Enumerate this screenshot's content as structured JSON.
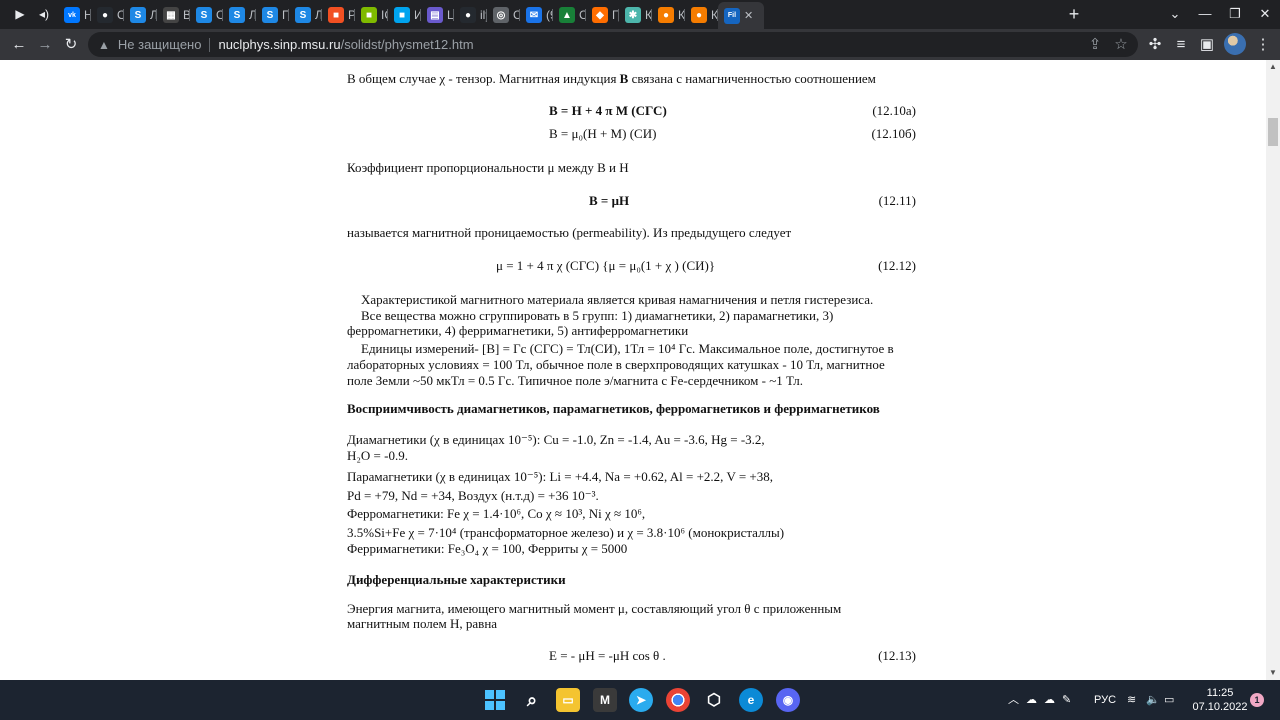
{
  "tabs": [
    {
      "label": "Но",
      "icon": "vk-icon",
      "color": "#0077ff",
      "glyph": "vk"
    },
    {
      "label": "OS",
      "icon": "github-icon",
      "color": "#24292f",
      "glyph": "●"
    },
    {
      "label": "Ла",
      "icon": "s-icon",
      "color": "#1e88e5",
      "glyph": "S"
    },
    {
      "label": "Ва",
      "icon": "grid-icon",
      "color": "#444444",
      "glyph": "▦"
    },
    {
      "label": "Ол",
      "icon": "s-icon",
      "color": "#1e88e5",
      "glyph": "S"
    },
    {
      "label": "Ле",
      "icon": "s-icon",
      "color": "#1e88e5",
      "glyph": "S"
    },
    {
      "label": "Пр",
      "icon": "s-icon",
      "color": "#1e88e5",
      "glyph": "S"
    },
    {
      "label": "Ла",
      "icon": "s-icon",
      "color": "#1e88e5",
      "glyph": "S"
    },
    {
      "label": "Рук",
      "icon": "windows-icon",
      "color": "#f25022",
      "glyph": "■"
    },
    {
      "label": "ICo",
      "icon": "windows-icon",
      "color": "#7fba00",
      "glyph": "■"
    },
    {
      "label": "Ин",
      "icon": "windows-icon",
      "color": "#00a4ef",
      "glyph": "■"
    },
    {
      "label": "Lab",
      "icon": "book-icon",
      "color": "#6a5acd",
      "glyph": "▤"
    },
    {
      "label": "ilya",
      "icon": "github-icon",
      "color": "#24292f",
      "glyph": "●"
    },
    {
      "label": "Co",
      "icon": "globe-icon",
      "color": "#5f6368",
      "glyph": "◎"
    },
    {
      "label": "(91",
      "icon": "mail-icon",
      "color": "#1a73e8",
      "glyph": "✉"
    },
    {
      "label": "Cla",
      "icon": "drive-icon",
      "color": "#188038",
      "glyph": "▲"
    },
    {
      "label": "Гра",
      "icon": "shape-icon",
      "color": "#ff6d00",
      "glyph": "◆"
    },
    {
      "label": "Ко",
      "icon": "star-icon",
      "color": "#4db6ac",
      "glyph": "✱"
    },
    {
      "label": "Ко",
      "icon": "orange-icon",
      "color": "#f57c00",
      "glyph": "●"
    },
    {
      "label": "Ко",
      "icon": "orange-icon",
      "color": "#f57c00",
      "glyph": "●"
    },
    {
      "label": "Fili",
      "icon": "fil-icon",
      "color": "#1565c0",
      "glyph": "Fil"
    }
  ],
  "toolbar": {
    "security_label": "Не защищено",
    "host": "nuclphys.sinp.msu.ru",
    "path": "/solidst/physmet12.htm"
  },
  "content": {
    "p1_a": "В общем случае ",
    "chi": "χ",
    "p1_b": " - тензор. Магнитная индукция ",
    "B": "B",
    "p1_c": " связана с намагниченностью соотношением",
    "eq10a": "B = H + 4 π M (СГС)",
    "eq10a_num": "(12.10а)",
    "eq10b": "B = μ₀(H + M) (СИ)",
    "eq10b_num": "(12.10б)",
    "p2": "Коэффициент пропорциональности μ между B и H",
    "eq11": "B = μH",
    "eq11_num": "(12.11)",
    "p3": "называется магнитной проницаемостью (permeability). Из предыдущего следует",
    "eq12": "μ = 1 + 4 π χ (СГС) {μ = μ₀(1 + χ ) (СИ)}",
    "eq12_num": "(12.12)",
    "para1": "Характеристикой магнитного материала является кривая намагничения и петля гистерезиса.",
    "para2_l1": "Все вещества можно сгруппировать в 5 групп: 1) диамагнетики, 2) парамагнетики, 3)",
    "para2_l2": "ферромагнетики, 4) ферримагнетики, 5) антиферромагнетики",
    "para3_l1": "Единицы измерений- [B] = Гс (СГС) = Тл(СИ), 1Тл = 10⁴ Гс. Максимальное поле, достигнутое в",
    "para3_l2": "лабораторных условиях = 100 Тл, обычное поле в сверхпроводящих катушках - 10 Тл, магнитное",
    "para3_l3": "поле Земли ~50 мкТл = 0.5 Гс. Типичное поле э/магнита с Fe-сердечником - ~1 Тл.",
    "heading1": "Восприимчивость диамагнетиков, парамагнетиков, ферромагнетиков и ферримагнетиков",
    "dia_l1": "Диамагнетики (χ в единицах 10⁻⁵): Cu = -1.0, Zn = -1.4, Au = -3.6, Hg = -3.2,",
    "dia_l2": "H₂O = -0.9.",
    "para_l1": "Парамагнетики (χ в единицах 10⁻⁵): Li = +4.4, Na = +0.62, Al = +2.2, V = +38,",
    "para_l2": "Pd = +79, Nd = +34, Воздух (н.т.д) = +36 10⁻³.",
    "ferro_l1": "Ферромагнетики: Fe χ = 1.4·10⁶, Co χ ≈ 10³, Ni χ ≈ 10⁶,",
    "ferro_l2": "3.5%Si+Fe χ = 7·10⁴ (трансформаторное железо) и χ = 3.8·10⁶ (монокристаллы)",
    "ferri_l1": "Ферримагнетики: Fe₃O₄ χ = 100, Ферриты χ = 5000",
    "heading2": "Дифференциальные характеристики",
    "energy_l1": "Энергия магнита, имеющего магнитный момент μ, составляющий угол θ с приложенным",
    "energy_l2": "магнитным полем H, равна",
    "eq13": "E = - μH = -μH cos θ .",
    "eq13_num": "(12.13)"
  },
  "taskbar": {
    "lang": "РУС",
    "time": "11:25",
    "date": "07.10.2022",
    "notifications": "1"
  }
}
